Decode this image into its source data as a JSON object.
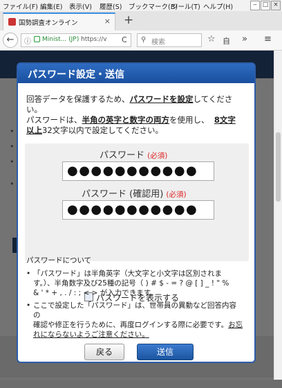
{
  "browser": {
    "menu": [
      "ファイル(F)",
      "編集(E)",
      "表示(V)",
      "履歴(S)",
      "ブックマーク(B)",
      "ツール(T)",
      "ヘルプ(H)"
    ],
    "window_buttons": [
      "‒",
      "□",
      "×"
    ],
    "tab": {
      "title": "国勢調査オンライン",
      "close": "×"
    },
    "new_tab": "+",
    "back": "←",
    "url": {
      "info": "ⓘ",
      "site": "Minist... (JP)",
      "text": "https://v"
    },
    "reload": "C",
    "search_placeholder": "検索",
    "toolbar_icons": {
      "bookmark": "☆",
      "library": "自",
      "overflow": "»",
      "menu": "≡"
    }
  },
  "modal": {
    "title": "パスワード設定・送信",
    "intro": {
      "line1_a": "回答データを保護するため、",
      "line1_b": "パスワードを設定",
      "line1_c": "してくださ",
      "line2": "い。",
      "line3_a": "パスワードは、",
      "line3_b": "半角の英字と数字の両方",
      "line3_c": "を使用し、",
      "line3_d": "8文字",
      "line4_a": "以上",
      "line4_b": "32文字以内で設定してください。"
    },
    "password": {
      "label": "パスワード",
      "required": "(必須)",
      "value": "●●●●●●●●●●●"
    },
    "password_confirm": {
      "label": "パスワード (確認用)",
      "required": "(必須)",
      "value": "●●●●●●●●●●●"
    },
    "show_password_label": "パスワードを表示する",
    "notes": {
      "title": "パスワードについて",
      "item1_a": "「パスワード」は半角英字（大文字と小文字は区別されま",
      "item1_b": "す。）、半角数字及び25種の記号（ ) # $ - = ? @ [ ] _ ! \" %",
      "item1_c": "& ' * + , . / : ; < > が入力できます。",
      "item2_a": "ここで設定した「パスワード」は、世帯員の異動など回答内容の",
      "item2_b": "確認や修正を行うために、再度ログインする際に必要です。",
      "item2_c": "お忘",
      "item2_d": "れにならないようご注意ください。"
    },
    "buttons": {
      "back": "戻る",
      "send": "送信"
    }
  }
}
